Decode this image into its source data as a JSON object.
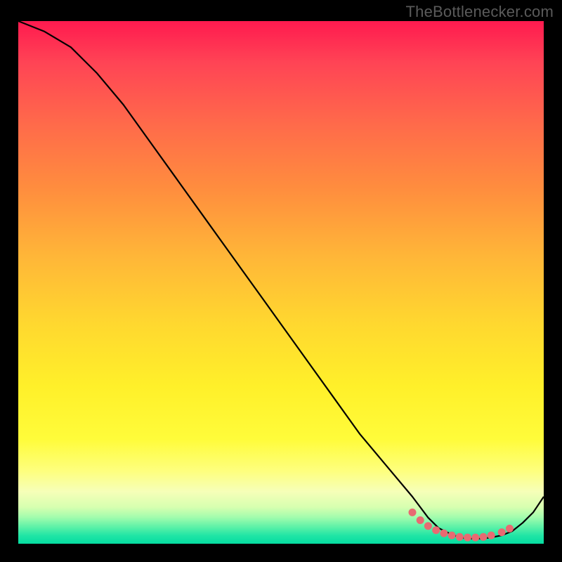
{
  "attribution": "TheBottlenecker.com",
  "chart_data": {
    "type": "line",
    "title": "",
    "xlabel": "",
    "ylabel": "",
    "xlim": [
      0,
      100
    ],
    "ylim": [
      0,
      100
    ],
    "series": [
      {
        "name": "curve",
        "x": [
          0,
          5,
          10,
          15,
          20,
          25,
          30,
          35,
          40,
          45,
          50,
          55,
          60,
          65,
          70,
          75,
          78,
          80,
          82,
          84,
          86,
          88,
          90,
          92,
          94,
          96,
          98,
          100
        ],
        "y": [
          100,
          98,
          95,
          90,
          84,
          77,
          70,
          63,
          56,
          49,
          42,
          35,
          28,
          21,
          15,
          9,
          5,
          3,
          2,
          1.2,
          1,
          1,
          1.2,
          1.6,
          2.4,
          4,
          6,
          9
        ]
      }
    ],
    "markers": {
      "name": "highlight-dots",
      "color": "#e86a72",
      "x": [
        75,
        76.5,
        78,
        79.5,
        81,
        82.5,
        84,
        85.5,
        87,
        88.5,
        90,
        92,
        93.5
      ],
      "y": [
        6,
        4.5,
        3.4,
        2.6,
        2.0,
        1.6,
        1.3,
        1.2,
        1.2,
        1.3,
        1.6,
        2.2,
        2.9
      ]
    }
  }
}
